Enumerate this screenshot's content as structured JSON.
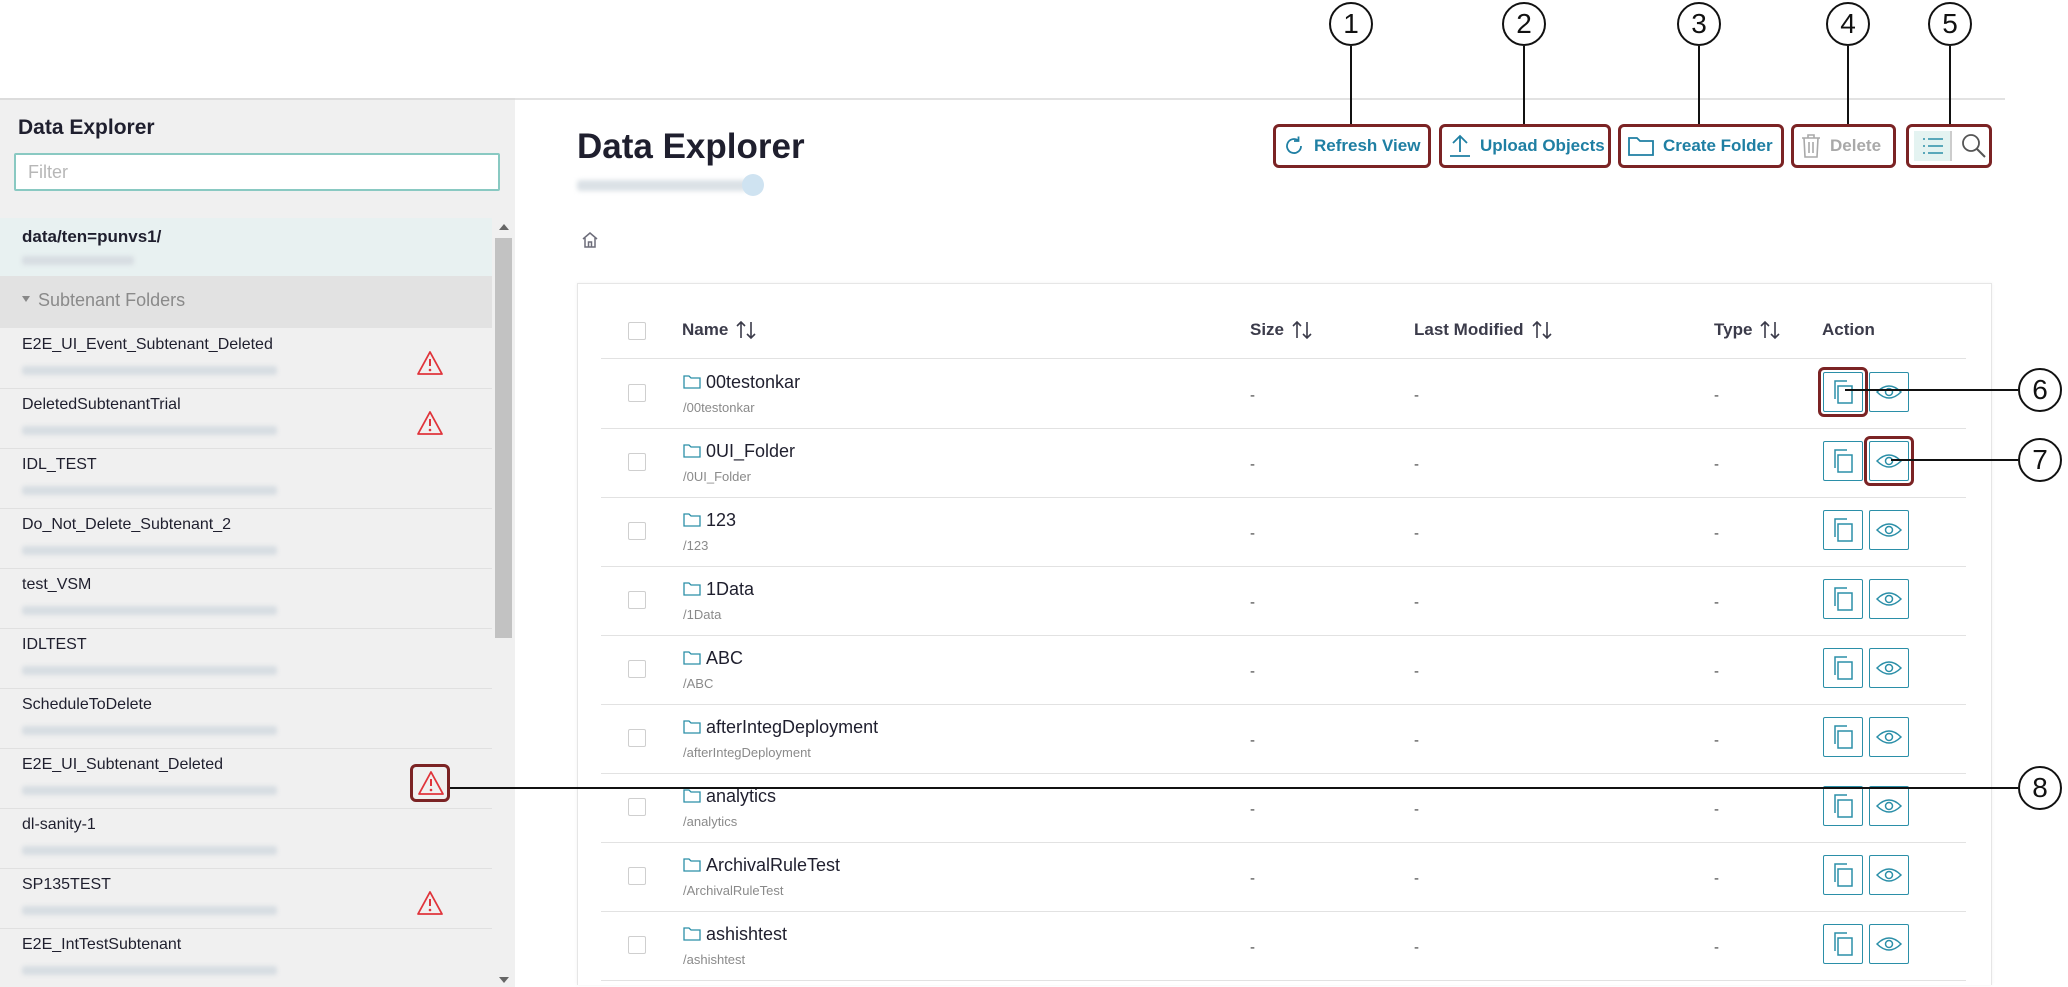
{
  "sidebar": {
    "title": "Data Explorer",
    "filter_placeholder": "Filter",
    "root_label": "data/ten=punvs1/",
    "section_label": "Subtenant Folders",
    "items": [
      {
        "name": "E2E_UI_Event_Subtenant_Deleted",
        "warning": true
      },
      {
        "name": "DeletedSubtenantTrial",
        "warning": true
      },
      {
        "name": "IDL_TEST",
        "warning": false
      },
      {
        "name": "Do_Not_Delete_Subtenant_2",
        "warning": false
      },
      {
        "name": "test_VSM",
        "warning": false
      },
      {
        "name": "IDLTEST",
        "warning": false
      },
      {
        "name": "ScheduleToDelete",
        "warning": false
      },
      {
        "name": "E2E_UI_Subtenant_Deleted",
        "warning": true
      },
      {
        "name": "dl-sanity-1",
        "warning": false
      },
      {
        "name": "SP135TEST",
        "warning": true
      },
      {
        "name": "E2E_IntTestSubtenant",
        "warning": false
      }
    ]
  },
  "main": {
    "title": "Data Explorer",
    "toolbar": {
      "refresh_label": "Refresh View",
      "upload_label": "Upload Objects",
      "create_folder_label": "Create Folder",
      "delete_label": "Delete"
    },
    "table": {
      "headers": {
        "name": "Name",
        "size": "Size",
        "last_modified": "Last Modified",
        "type": "Type",
        "action": "Action"
      },
      "rows": [
        {
          "name": "00testonkar",
          "path": "/00testonkar",
          "size": "-",
          "last_modified": "-",
          "type": "-"
        },
        {
          "name": "0UI_Folder",
          "path": "/0UI_Folder",
          "size": "-",
          "last_modified": "-",
          "type": "-"
        },
        {
          "name": "123",
          "path": "/123",
          "size": "-",
          "last_modified": "-",
          "type": "-"
        },
        {
          "name": "1Data",
          "path": "/1Data",
          "size": "-",
          "last_modified": "-",
          "type": "-"
        },
        {
          "name": "ABC",
          "path": "/ABC",
          "size": "-",
          "last_modified": "-",
          "type": "-"
        },
        {
          "name": "afterIntegDeployment",
          "path": "/afterIntegDeployment",
          "size": "-",
          "last_modified": "-",
          "type": "-"
        },
        {
          "name": "analytics",
          "path": "/analytics",
          "size": "-",
          "last_modified": "-",
          "type": "-"
        },
        {
          "name": "ArchivalRuleTest",
          "path": "/ArchivalRuleTest",
          "size": "-",
          "last_modified": "-",
          "type": "-"
        },
        {
          "name": "ashishtest",
          "path": "/ashishtest",
          "size": "-",
          "last_modified": "-",
          "type": "-"
        }
      ]
    }
  },
  "callouts": [
    "1",
    "2",
    "3",
    "4",
    "5",
    "6",
    "7",
    "8"
  ],
  "colors": {
    "accent": "#1f7fa3",
    "highlight": "#7b2324",
    "warning": "#e0343b"
  }
}
